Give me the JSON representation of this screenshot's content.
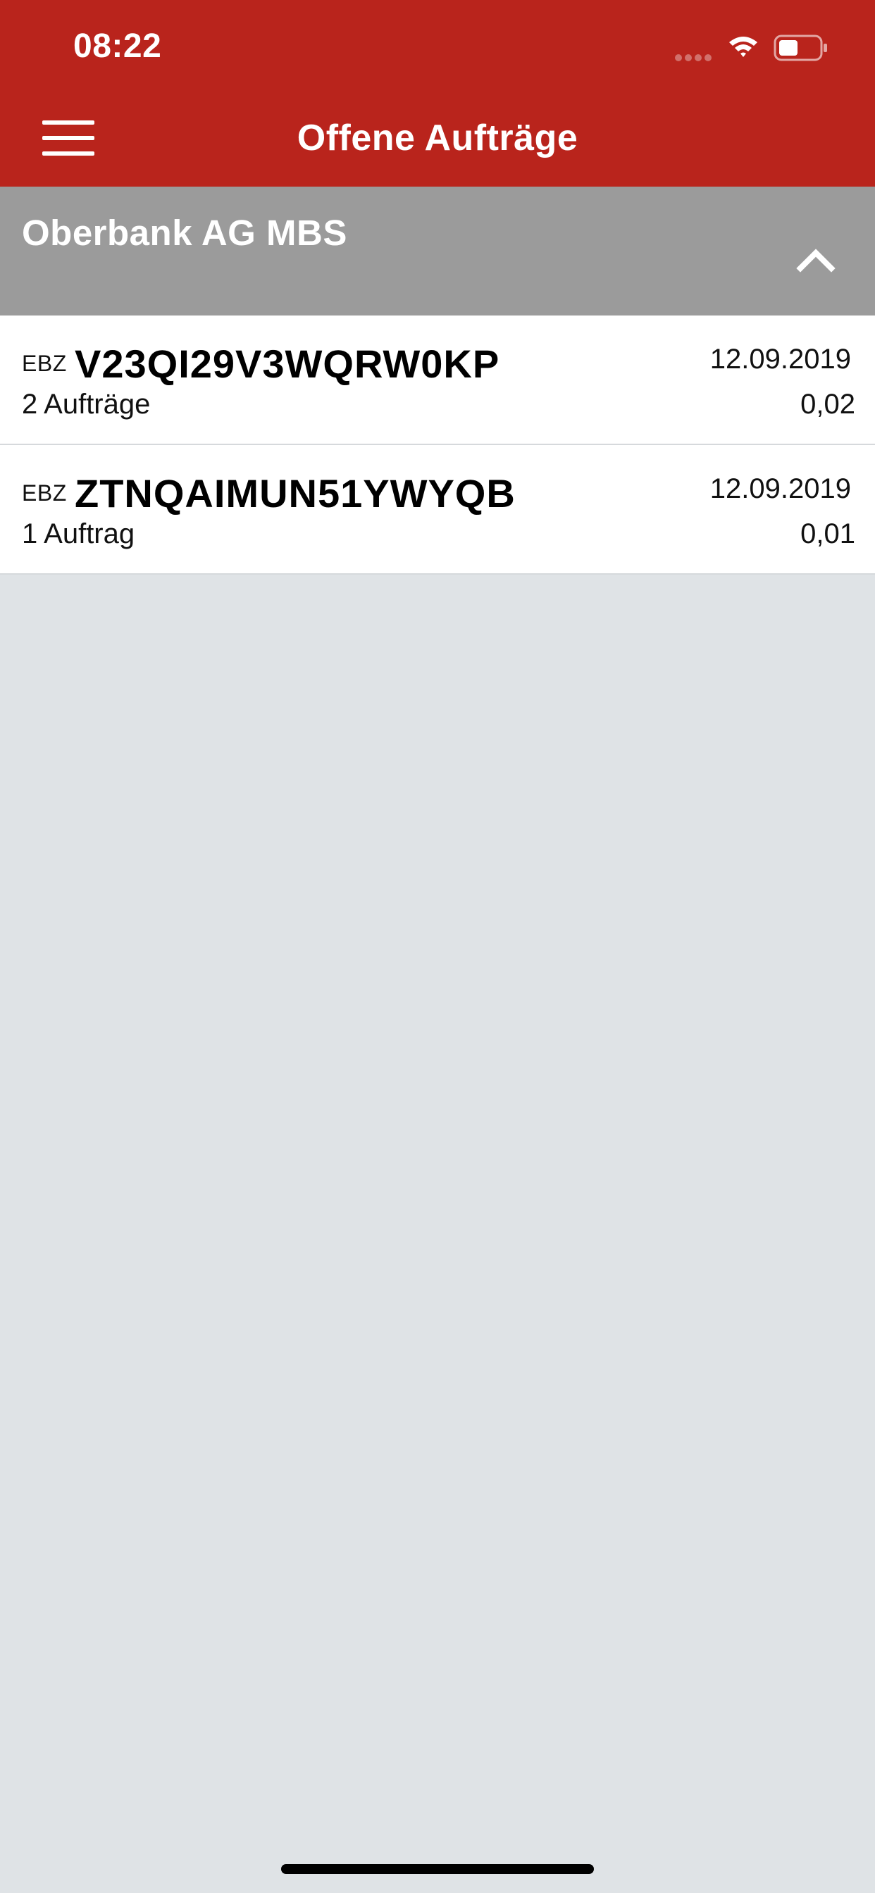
{
  "status_bar": {
    "time": "08:22",
    "icons": [
      "signal-dots-icon",
      "wifi-icon",
      "battery-icon"
    ]
  },
  "nav": {
    "title": "Offene Aufträge",
    "menu_icon": "hamburger-menu-icon"
  },
  "section": {
    "title": "Oberbank AG MBS",
    "toggle_icon": "chevron-up-icon"
  },
  "orders": [
    {
      "prefix": "EBZ",
      "id": "V23QI29V3WQRW0KP",
      "count": "2 Aufträge",
      "date": "12.09.2019",
      "amount": "0,02"
    },
    {
      "prefix": "EBZ",
      "id": "ZTNQAIMUN51YWYQB",
      "count": "1 Auftrag",
      "date": "12.09.2019",
      "amount": "0,01"
    }
  ],
  "colors": {
    "header_red": "#b9241c",
    "section_gray": "#9b9b9b",
    "background": "#dfe3e6"
  }
}
